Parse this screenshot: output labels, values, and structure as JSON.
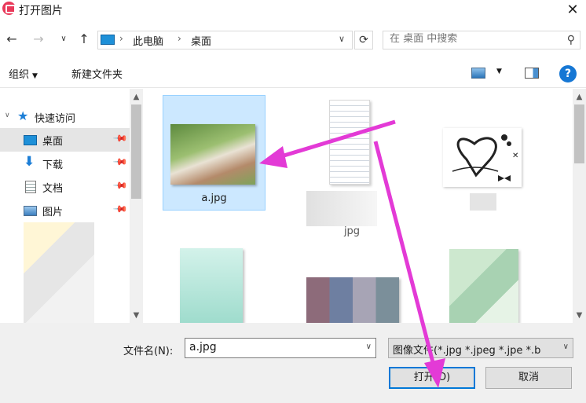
{
  "window": {
    "title": "打开图片",
    "close_glyph": "✕"
  },
  "address": {
    "path": [
      "此电脑",
      "桌面"
    ],
    "search_placeholder": "在 桌面 中搜索"
  },
  "toolbar": {
    "organize": "组织",
    "new_folder": "新建文件夹"
  },
  "sidebar": {
    "items": [
      {
        "label": "快速访问",
        "icon": "star-icon"
      },
      {
        "label": "桌面",
        "icon": "desktop-icon",
        "active": true
      },
      {
        "label": "下载",
        "icon": "download-icon"
      },
      {
        "label": "文档",
        "icon": "document-icon"
      },
      {
        "label": "图片",
        "icon": "pictures-icon"
      }
    ]
  },
  "files": [
    {
      "label": "a.jpg",
      "selected": true
    },
    {
      "label": "jpg"
    }
  ],
  "footer": {
    "filename_label": "文件名(N):",
    "filename_value": "a.jpg",
    "filetype_value": "图像文件(*.jpg *.jpeg *.jpe *.b",
    "open_button": "打开(O)",
    "cancel_button": "取消"
  },
  "colors": {
    "accent": "#0078d7",
    "annotation_arrow": "#e33ad6",
    "selection": "#cce8ff"
  }
}
